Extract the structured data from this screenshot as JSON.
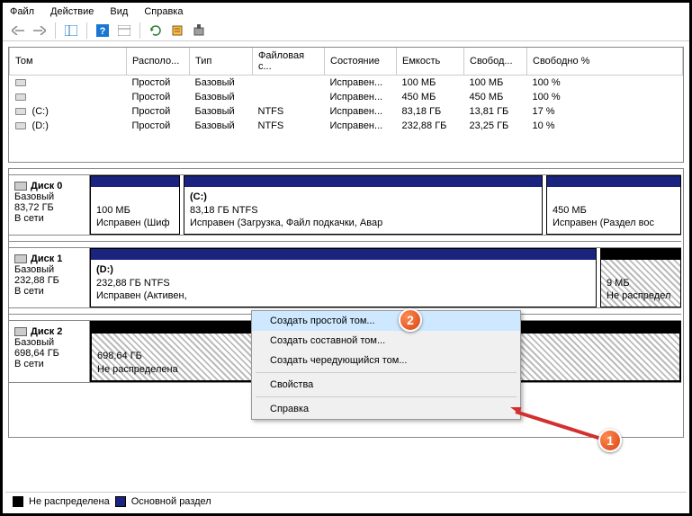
{
  "menubar": {
    "file": "Файл",
    "action": "Действие",
    "view": "Вид",
    "help": "Справка"
  },
  "columns": {
    "volume": "Том",
    "layout": "Располо...",
    "type": "Тип",
    "fs": "Файловая с...",
    "status": "Состояние",
    "capacity": "Емкость",
    "free": "Свобод...",
    "freepct": "Свободно %"
  },
  "rows": [
    {
      "volume": "",
      "layout": "Простой",
      "type": "Базовый",
      "fs": "",
      "status": "Исправен...",
      "capacity": "100 МБ",
      "free": "100 МБ",
      "freepct": "100 %"
    },
    {
      "volume": "",
      "layout": "Простой",
      "type": "Базовый",
      "fs": "",
      "status": "Исправен...",
      "capacity": "450 МБ",
      "free": "450 МБ",
      "freepct": "100 %"
    },
    {
      "volume": " (C:)",
      "layout": "Простой",
      "type": "Базовый",
      "fs": "NTFS",
      "status": "Исправен...",
      "capacity": "83,18 ГБ",
      "free": "13,81 ГБ",
      "freepct": "17 %"
    },
    {
      "volume": " (D:)",
      "layout": "Простой",
      "type": "Базовый",
      "fs": "NTFS",
      "status": "Исправен...",
      "capacity": "232,88 ГБ",
      "free": "23,25 ГБ",
      "freepct": "10 %"
    }
  ],
  "disks": {
    "d0": {
      "name": "Диск 0",
      "type": "Базовый",
      "size": "83,72 ГБ",
      "status": "В сети",
      "p0": {
        "line1": "",
        "line2": "100 МБ",
        "line3": "Исправен (Шиф"
      },
      "p1": {
        "line1": "(C:)",
        "line2": "83,18 ГБ NTFS",
        "line3": "Исправен (Загрузка, Файл подкачки, Авар"
      },
      "p2": {
        "line1": "",
        "line2": "450 МБ",
        "line3": "Исправен (Раздел вос"
      }
    },
    "d1": {
      "name": "Диск 1",
      "type": "Базовый",
      "size": "232,88 ГБ",
      "status": "В сети",
      "p0": {
        "line1": "(D:)",
        "line2": "232,88 ГБ NTFS",
        "line3": "Исправен (Активен,"
      },
      "p1": {
        "line1": "",
        "line2": "9 МБ",
        "line3": "Не распредел"
      }
    },
    "d2": {
      "name": "Диск 2",
      "type": "Базовый",
      "size": "698,64 ГБ",
      "status": "В сети",
      "p0": {
        "line1": "",
        "line2": "698,64 ГБ",
        "line3": "Не распределена"
      }
    }
  },
  "contextmenu": {
    "simple": "Создать простой том...",
    "spanned": "Создать составной том...",
    "striped": "Создать чередующийся том...",
    "props": "Свойства",
    "help": "Справка"
  },
  "legend": {
    "unalloc": "Не распределена",
    "primary": "Основной раздел"
  },
  "badges": {
    "one": "1",
    "two": "2"
  }
}
